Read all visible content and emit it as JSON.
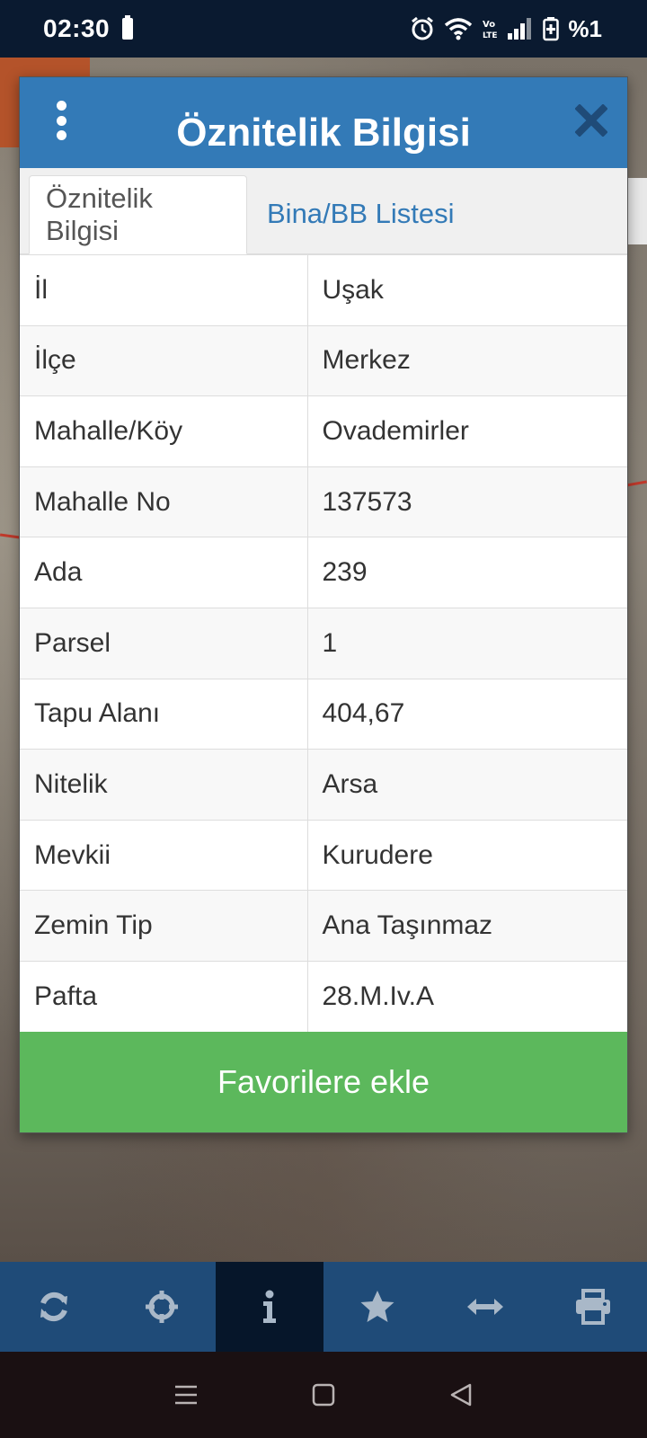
{
  "status_bar": {
    "time": "02:30",
    "battery_text": "%1"
  },
  "dialog": {
    "title": "Öznitelik Bilgisi",
    "tabs": [
      {
        "label": "Öznitelik Bilgisi",
        "active": true
      },
      {
        "label": "Bina/BB Listesi",
        "active": false
      }
    ],
    "rows": [
      {
        "key": "İl",
        "value": "Uşak"
      },
      {
        "key": "İlçe",
        "value": "Merkez"
      },
      {
        "key": "Mahalle/Köy",
        "value": "Ovademirler"
      },
      {
        "key": "Mahalle No",
        "value": "137573"
      },
      {
        "key": "Ada",
        "value": "239"
      },
      {
        "key": "Parsel",
        "value": "1"
      },
      {
        "key": "Tapu Alanı",
        "value": "404,67"
      },
      {
        "key": "Nitelik",
        "value": "Arsa"
      },
      {
        "key": "Mevkii",
        "value": "Kurudere"
      },
      {
        "key": "Zemin Tip",
        "value": "Ana Taşınmaz"
      },
      {
        "key": "Pafta",
        "value": "28.M.Iv.A"
      }
    ],
    "favorite_button": "Favorilere ekle"
  },
  "toolbar": {
    "items": [
      {
        "icon": "refresh-icon",
        "active": false
      },
      {
        "icon": "crosshair-icon",
        "active": false
      },
      {
        "icon": "info-icon",
        "active": true
      },
      {
        "icon": "star-icon",
        "active": false
      },
      {
        "icon": "measure-arrows-icon",
        "active": false
      },
      {
        "icon": "print-icon",
        "active": false
      }
    ]
  },
  "colors": {
    "header_blue": "#337ab7",
    "success_green": "#5cb85c",
    "toolbar_blue": "#1f4b78",
    "toolbar_active": "#06162a",
    "status_bar": "#0a1a30"
  }
}
